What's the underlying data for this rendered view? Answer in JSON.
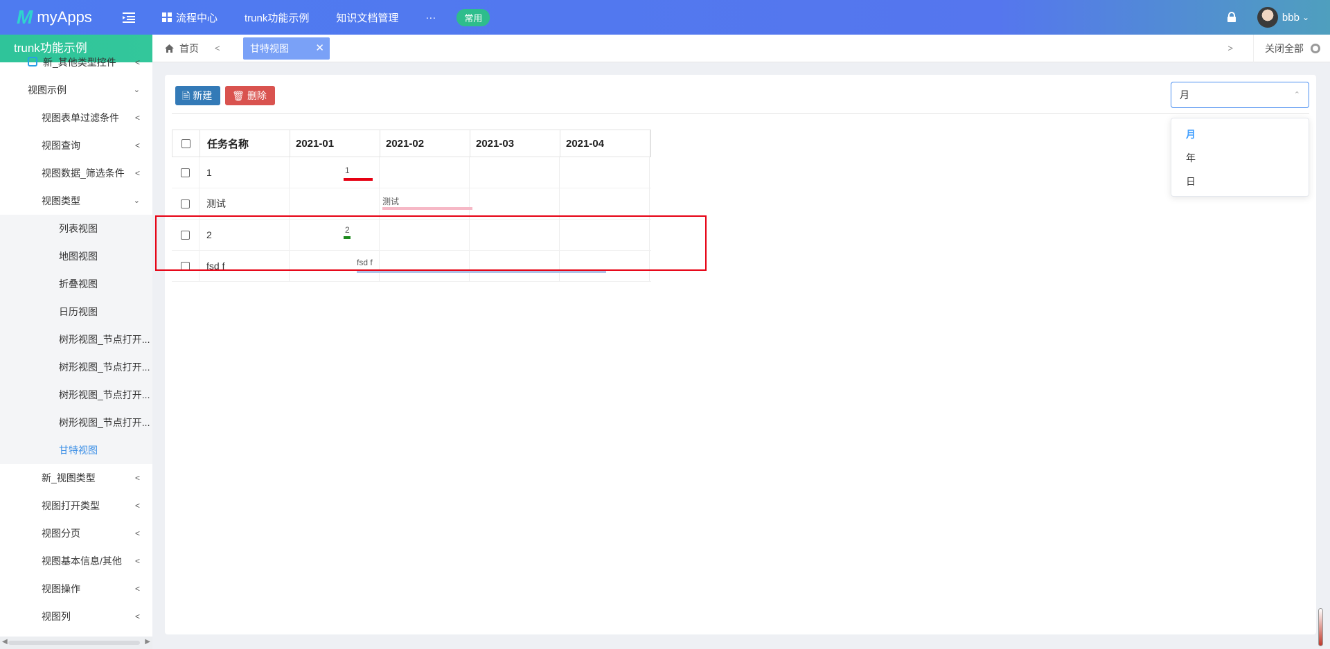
{
  "header": {
    "logo_mark": "M",
    "app_name": "myApps",
    "nav": [
      {
        "label": "流程中心"
      },
      {
        "label": "trunk功能示例"
      },
      {
        "label": "知识文档管理"
      }
    ],
    "more": "···",
    "pill": "常用",
    "user": "bbb"
  },
  "sidebar": {
    "title": "trunk功能示例",
    "items": [
      {
        "label": "新_其他类型控件"
      },
      {
        "label": "视图示例"
      },
      {
        "label": "视图表单过滤条件"
      },
      {
        "label": "视图查询"
      },
      {
        "label": "视图数据_筛选条件"
      },
      {
        "label": "视图类型"
      },
      {
        "label": "列表视图"
      },
      {
        "label": "地图视图"
      },
      {
        "label": "折叠视图"
      },
      {
        "label": "日历视图"
      },
      {
        "label": "树形视图_节点打开..."
      },
      {
        "label": "树形视图_节点打开..."
      },
      {
        "label": "树形视图_节点打开..."
      },
      {
        "label": "树形视图_节点打开..."
      },
      {
        "label": "甘特视图"
      },
      {
        "label": "新_视图类型"
      },
      {
        "label": "视图打开类型"
      },
      {
        "label": "视图分页"
      },
      {
        "label": "视图基本信息/其他"
      },
      {
        "label": "视图操作"
      },
      {
        "label": "视图列"
      }
    ]
  },
  "tabs": {
    "home": "首页",
    "active": "甘特视图",
    "close_all": "关闭全部"
  },
  "toolbar": {
    "new_label": "新建",
    "delete_label": "删除"
  },
  "view_select": {
    "value": "月",
    "options": [
      "月",
      "年",
      "日"
    ],
    "selected_index": 0
  },
  "gantt": {
    "headers": [
      "任务名称",
      "2021-01",
      "2021-02",
      "2021-03",
      "2021-04"
    ],
    "rows": [
      {
        "name": "1",
        "bar_label": "1",
        "bar_color": "#e60012"
      },
      {
        "name": "测试",
        "bar_label": "测试",
        "bar_color": "#f6b8c6"
      },
      {
        "name": "2",
        "bar_label": "2",
        "bar_color": "#1e8a1e"
      },
      {
        "name": "fsd f",
        "bar_label": "fsd f",
        "bar_color": "#aec2e8"
      }
    ]
  },
  "colors": {
    "header_bg": "#4e7bf0",
    "sidebar_title_bg": "#2fc49a",
    "active_tab": "#7aa1f7",
    "highlight_box": "#e60012"
  }
}
